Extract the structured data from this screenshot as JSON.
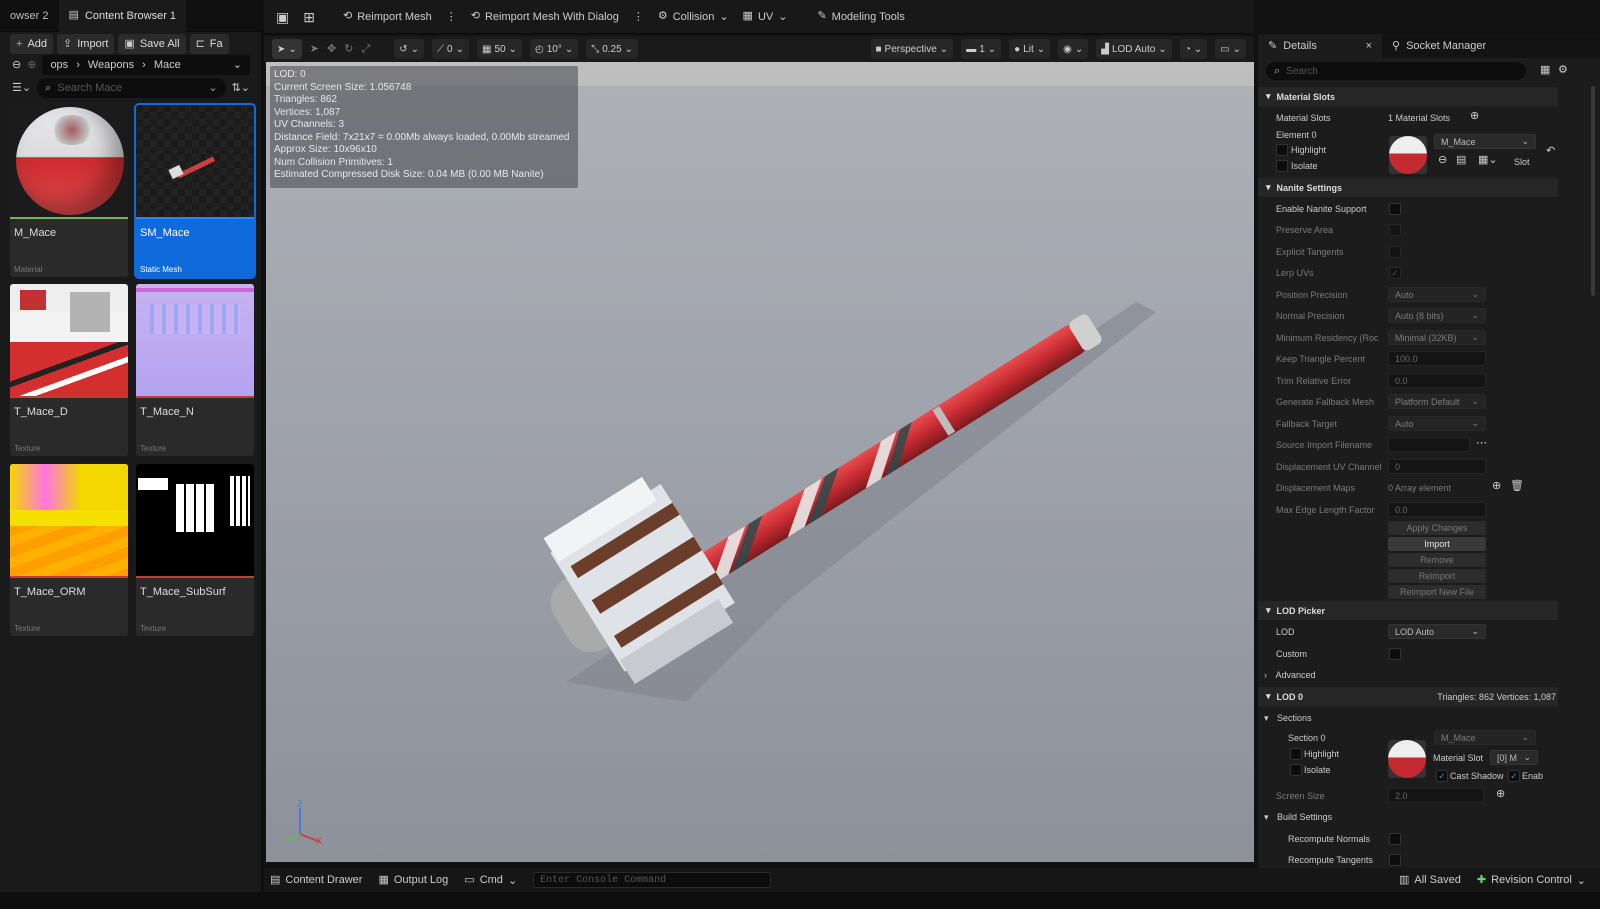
{
  "content_browser": {
    "tabs": [
      "owser 2",
      "Content Browser 1"
    ],
    "toolbar": {
      "add": "Add",
      "import": "Import",
      "save_all": "Save All",
      "fab": "Fa"
    },
    "breadcrumb": [
      "ops",
      "Weapons",
      "Mace"
    ],
    "search_placeholder": "Search Mace",
    "assets": [
      {
        "name": "M_Mace",
        "type": "Material"
      },
      {
        "name": "SM_Mace",
        "type": "Static Mesh"
      },
      {
        "name": "T_Mace_D",
        "type": "Texture"
      },
      {
        "name": "T_Mace_N",
        "type": "Texture"
      },
      {
        "name": "T_Mace_ORM",
        "type": "Texture"
      },
      {
        "name": "T_Mace_SubSurf",
        "type": "Texture"
      }
    ]
  },
  "toolbar": {
    "reimport_mesh": "Reimport Mesh",
    "reimport_dialog": "Reimport Mesh With Dialog",
    "collision": "Collision",
    "uv": "UV",
    "modeling_tools": "Modeling Tools"
  },
  "viewport_toolbar": {
    "rotate_snap": "0",
    "grid": "50",
    "angle": "10°",
    "scale": "0.25",
    "perspective": "Perspective",
    "camera_speed": "1",
    "lit": "Lit",
    "lod": "LOD Auto"
  },
  "stats": [
    "LOD:  0",
    "Current Screen Size:  1.056748",
    "Triangles:  862",
    "Vertices:  1,087",
    "UV Channels:  3",
    "Distance Field:  7x21x7 = 0.00Mb always loaded, 0.00Mb streamed",
    "Approx Size: 10x96x10",
    "Num Collision Primitives:  1",
    "Estimated Compressed Disk Size: 0.04 MB (0.00 MB Nanite)"
  ],
  "details": {
    "tab_details": "Details",
    "tab_socket": "Socket Manager",
    "search_placeholder": "Search",
    "material_slots_section": "Material Slots",
    "material_slots_label": "Material Slots",
    "material_slots_value": "1 Material Slots",
    "element0": "Element 0",
    "highlight": "Highlight",
    "isolate": "Isolate",
    "material": "M_Mace",
    "slot": "Slot",
    "nanite_section": "Nanite Settings",
    "nanite": {
      "enable": "Enable Nanite Support",
      "preserve_area": "Preserve Area",
      "explicit_tangents": "Explicit Tangents",
      "lerp_uvs": "Lerp UVs",
      "position_precision": "Position Precision",
      "position_precision_val": "Auto",
      "normal_precision": "Normal Precision",
      "normal_precision_val": "Auto (8 bits)",
      "min_residency": "Minimum Residency (Roc",
      "min_residency_val": "Minimal (32KB)",
      "keep_triangle": "Keep Triangle Percent",
      "keep_triangle_val": "100.0",
      "trim_error": "Trim Relative Error",
      "trim_error_val": "0.0",
      "gen_fallback": "Generate Fallback Mesh",
      "gen_fallback_val": "Platform Default",
      "fallback_target": "Fallback Target",
      "fallback_target_val": "Auto",
      "source_import": "Source Import Filename",
      "disp_uv": "Displacement UV Channel",
      "disp_uv_val": "0",
      "disp_maps": "Displacement Maps",
      "disp_maps_val": "0 Array element",
      "max_edge": "Max Edge Length Factor",
      "max_edge_val": "0.0",
      "apply_changes": "Apply Changes",
      "import": "Import",
      "remove": "Remove",
      "reimport": "Reimport",
      "reimport_new": "Reimport New File"
    },
    "lod_picker_section": "LOD Picker",
    "lod_label": "LOD",
    "lod_value": "LOD Auto",
    "custom": "Custom",
    "advanced": "Advanced",
    "lod0": "LOD 0",
    "lod0_info": "Triangles: 862   Vertices: 1,087",
    "sections": "Sections",
    "section0": "Section 0",
    "section_material": "M_Mace",
    "material_slot_label": "Material Slot",
    "material_slot_value": "[0] M",
    "cast_shadow": "Cast Shadow",
    "enab": "Enab",
    "screen_size": "Screen Size",
    "screen_size_val": "2.0",
    "build_settings": "Build Settings",
    "recompute_normals": "Recompute Normals",
    "recompute_tangents": "Recompute Tangents"
  },
  "bottom": {
    "content_drawer": "Content Drawer",
    "output_log": "Output Log",
    "cmd": "Cmd",
    "console_placeholder": "Enter Console Command",
    "all_saved": "All Saved",
    "revision_control": "Revision Control"
  },
  "colors": {
    "accent": "#0f6bdc",
    "panel": "#1c1c1c",
    "mace_red": "#d8343a"
  }
}
